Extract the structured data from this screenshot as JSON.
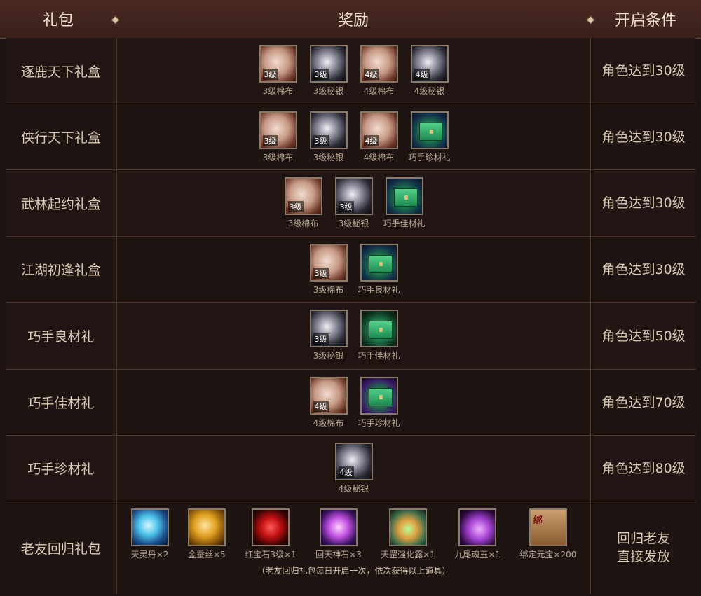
{
  "header": {
    "col1": "礼包",
    "col2": "奖励",
    "col3": "开启条件"
  },
  "rows": [
    {
      "name": "逐鹿天下礼盒",
      "condition": "角色达到30级",
      "items": [
        {
          "icon": "cloth-icon",
          "level": "3级",
          "label": "3级棉布"
        },
        {
          "icon": "silver-ore-icon",
          "level": "3级",
          "label": "3级秘银"
        },
        {
          "icon": "cloth-icon",
          "level": "4级",
          "label": "4级棉布"
        },
        {
          "icon": "silver-ore-icon",
          "level": "4级",
          "label": "4级秘银"
        }
      ]
    },
    {
      "name": "侠行天下礼盒",
      "condition": "角色达到30级",
      "items": [
        {
          "icon": "cloth-icon",
          "level": "3级",
          "label": "3级棉布"
        },
        {
          "icon": "silver-ore-icon",
          "level": "3级",
          "label": "3级秘银"
        },
        {
          "icon": "cloth-icon",
          "level": "4级",
          "label": "4级棉布"
        },
        {
          "icon": "chest-icon",
          "level": "",
          "label": "巧手珍材礼"
        }
      ]
    },
    {
      "name": "武林起约礼盒",
      "condition": "角色达到30级",
      "items": [
        {
          "icon": "cloth-icon",
          "level": "3级",
          "label": "3级棉布"
        },
        {
          "icon": "silver-ore-icon",
          "level": "3级",
          "label": "3级秘银"
        },
        {
          "icon": "chest-icon",
          "level": "",
          "label": "巧手佳材礼"
        }
      ]
    },
    {
      "name": "江湖初逢礼盒",
      "condition": "角色达到30级",
      "items": [
        {
          "icon": "cloth-icon",
          "level": "3级",
          "label": "3级棉布"
        },
        {
          "icon": "chest-icon",
          "level": "",
          "label": "巧手良材礼"
        }
      ]
    },
    {
      "name": "巧手良材礼",
      "condition": "角色达到50级",
      "items": [
        {
          "icon": "silver-ore-icon",
          "level": "3级",
          "label": "3级秘银"
        },
        {
          "icon": "chest-icon",
          "level": "",
          "label": "巧手佳材礼"
        }
      ]
    },
    {
      "name": "巧手佳材礼",
      "condition": "角色达到70级",
      "items": [
        {
          "icon": "cloth-icon",
          "level": "4级",
          "label": "4级棉布"
        },
        {
          "icon": "chest-icon",
          "level": "",
          "label": "巧手珍材礼"
        }
      ]
    },
    {
      "name": "巧手珍材礼",
      "condition": "角色达到80级",
      "items": [
        {
          "icon": "silver-ore-icon",
          "level": "4级",
          "label": "4级秘银"
        }
      ]
    }
  ],
  "old_friend": {
    "name": "老友回归礼包",
    "condition_line1": "回归老友",
    "condition_line2": "直接发放",
    "items": [
      {
        "icon": "tianling-pill-icon",
        "label": "天灵丹×2"
      },
      {
        "icon": "gold-silk-icon",
        "label": "金蚕丝×5"
      },
      {
        "icon": "ruby-icon",
        "label": "红宝石3级×1"
      },
      {
        "icon": "divine-stone-icon",
        "label": "回天神石×3"
      },
      {
        "icon": "potion-icon",
        "label": "天罡强化露×1"
      },
      {
        "icon": "nine-tail-jade-icon",
        "label": "九尾魂玉×1"
      },
      {
        "icon": "bound-ingot-icon",
        "label": "绑定元宝×200"
      }
    ],
    "note": "（老友回归礼包每日开启一次，依次获得以上道具）",
    "yb_seal": "绑"
  }
}
